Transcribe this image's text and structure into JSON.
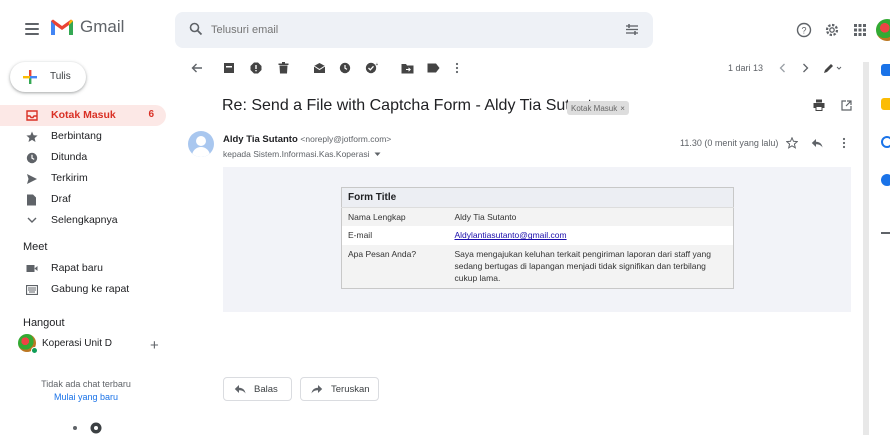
{
  "app": {
    "name": "Gmail"
  },
  "search": {
    "placeholder": "Telusuri email"
  },
  "compose": {
    "label": "Tulis"
  },
  "sidebar": {
    "items": [
      {
        "label": "Kotak Masuk",
        "count": "6",
        "icon": "inbox-icon",
        "active": true
      },
      {
        "label": "Berbintang",
        "icon": "star-icon"
      },
      {
        "label": "Ditunda",
        "icon": "clock-icon"
      },
      {
        "label": "Terkirim",
        "icon": "send-icon"
      },
      {
        "label": "Draf",
        "icon": "draft-icon"
      },
      {
        "label": "Selengkapnya",
        "icon": "chevron-down-icon"
      }
    ],
    "meet": {
      "title": "Meet",
      "items": [
        {
          "label": "Rapat baru",
          "icon": "video-icon"
        },
        {
          "label": "Gabung ke rapat",
          "icon": "keyboard-icon"
        }
      ]
    },
    "hangout": {
      "title": "Hangout",
      "user": "Koperasi Unit D",
      "no_chat": "Tidak ada chat terbaru",
      "start_new": "Mulai yang baru"
    }
  },
  "toolbar": {
    "pager": "1 dari 13"
  },
  "message": {
    "subject": "Re: Send a File with Captcha Form - Aldy Tia Sutanto",
    "label_chip": "Kotak Masuk",
    "label_chip_close": "×",
    "sender_name": "Aldy Tia Sutanto",
    "sender_email": "<noreply@jotform.com>",
    "to_line": "kepada Sistem.Informasi.Kas.Koperasi",
    "timestamp": "11.30 (0 menit yang lalu)",
    "form": {
      "title": "Form Title",
      "rows": [
        {
          "key": "Nama Lengkap",
          "value": "Aldy Tia Sutanto"
        },
        {
          "key": "E-mail",
          "value": "Aldylantiasutanto@gmail.com",
          "link": true
        },
        {
          "key": "Apa Pesan Anda?",
          "value": "Saya mengajukan keluhan terkait pengiriman laporan dari staff yang sedang bertugas di lapangan menjadi tidak signifikan dan terbilang cukup lama."
        }
      ]
    }
  },
  "reply": {
    "reply_label": "Balas",
    "forward_label": "Teruskan"
  },
  "colors": {
    "accent_red": "#d93025",
    "active_bg": "#fce8e6",
    "search_bg": "#eef1f6",
    "link": "#1a0dab"
  }
}
